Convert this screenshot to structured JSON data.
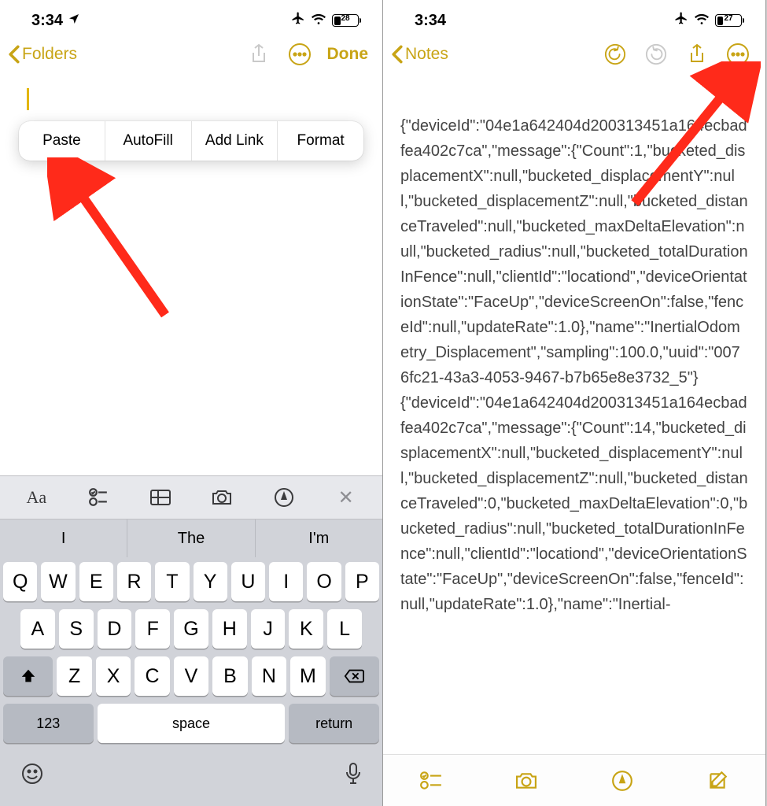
{
  "left": {
    "status": {
      "time": "3:34",
      "battery": "28",
      "battery_pct": 28
    },
    "nav": {
      "back_label": "Folders",
      "done_label": "Done"
    },
    "context_menu": {
      "paste": "Paste",
      "autofill": "AutoFill",
      "add_link": "Add Link",
      "format": "Format"
    },
    "format_bar": {
      "aa": "Aa"
    },
    "suggestions": {
      "s1": "I",
      "s2": "The",
      "s3": "I'm"
    },
    "keys": {
      "row1": [
        "Q",
        "W",
        "E",
        "R",
        "T",
        "Y",
        "U",
        "I",
        "O",
        "P"
      ],
      "row2": [
        "A",
        "S",
        "D",
        "F",
        "G",
        "H",
        "J",
        "K",
        "L"
      ],
      "row3": [
        "Z",
        "X",
        "C",
        "V",
        "B",
        "N",
        "M"
      ],
      "num": "123",
      "space": "space",
      "ret": "return"
    }
  },
  "right": {
    "status": {
      "time": "3:34",
      "battery": "27",
      "battery_pct": 27
    },
    "nav": {
      "back_label": "Notes"
    },
    "note_text": "{\"deviceId\":\"04e1a642404d200313451a164ecbadfea402c7ca\",\"message\":{\"Count\":1,\"bucketed_displacementX\":null,\"bucketed_displacementY\":null,\"bucketed_displacementZ\":null,\"bucketed_distanceTraveled\":null,\"bucketed_maxDeltaElevation\":null,\"bucketed_radius\":null,\"bucketed_totalDurationInFence\":null,\"clientId\":\"locationd\",\"deviceOrientationState\":\"FaceUp\",\"deviceScreenOn\":false,\"fenceId\":null,\"updateRate\":1.0},\"name\":\"InertialOdometry_Displacement\",\"sampling\":100.0,\"uuid\":\"0076fc21-43a3-4053-9467-b7b65e8e3732_5\"}\n{\"deviceId\":\"04e1a642404d200313451a164ecbadfea402c7ca\",\"message\":{\"Count\":14,\"bucketed_displacementX\":null,\"bucketed_displacementY\":null,\"bucketed_displacementZ\":null,\"bucketed_distanceTraveled\":0,\"bucketed_maxDeltaElevation\":0,\"bucketed_radius\":null,\"bucketed_totalDurationInFence\":null,\"clientId\":\"locationd\",\"deviceOrientationState\":\"FaceUp\",\"deviceScreenOn\":false,\"fenceId\":null,\"updateRate\":1.0},\"name\":\"Inertial-"
  }
}
